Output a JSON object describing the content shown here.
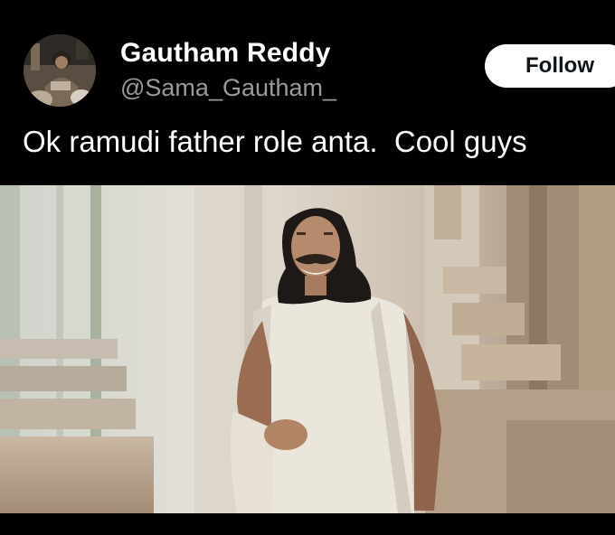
{
  "tweet": {
    "author": {
      "display_name": "Gautham Reddy",
      "handle": "@Sama_Gautham_",
      "avatar_icon": "profile-photo"
    },
    "follow_label": "Follow",
    "text": "Ok ramudi father role anta.  Cool guys",
    "media": {
      "icon": "photo-man-in-white-robe"
    }
  },
  "colors": {
    "background": "#000000",
    "text": "#ffffff",
    "handle": "#9a9a9a",
    "follow_bg": "#ffffff",
    "follow_text": "#0f1419"
  }
}
